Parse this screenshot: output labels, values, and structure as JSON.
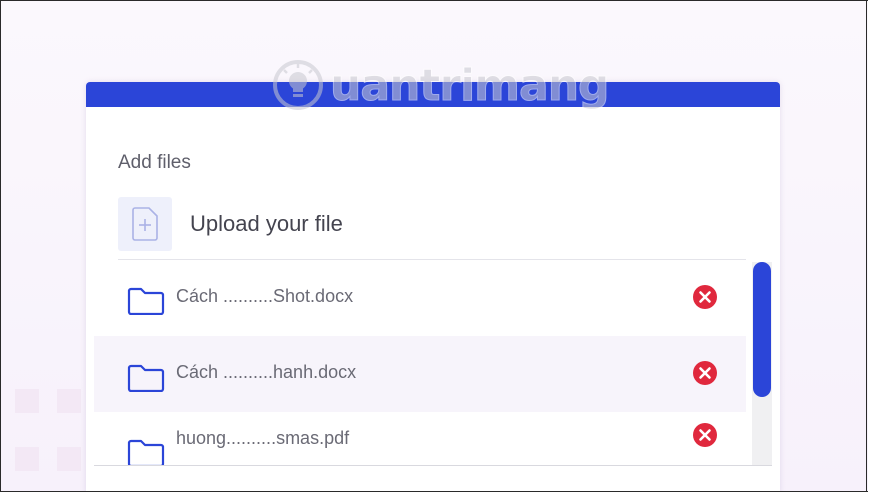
{
  "colors": {
    "accent": "#2b45d8",
    "remove": "#e0283d",
    "text_primary": "#44444f",
    "text_secondary": "#6a6a75",
    "background": "#f7f1fb"
  },
  "watermark": {
    "text": "uantrimang",
    "icon": "lightbulb-icon"
  },
  "uploader": {
    "section_label": "Add files",
    "upload_label": "Upload your file",
    "upload_icon": "add-file-icon"
  },
  "files": [
    {
      "name": "Cách ..........Shot.docx",
      "icon": "folder-icon",
      "action_icon": "remove-icon"
    },
    {
      "name": "Cách ..........hanh.docx",
      "icon": "folder-icon",
      "action_icon": "remove-icon"
    },
    {
      "name": "huong..........smas.pdf",
      "icon": "folder-icon",
      "action_icon": "remove-icon"
    }
  ]
}
